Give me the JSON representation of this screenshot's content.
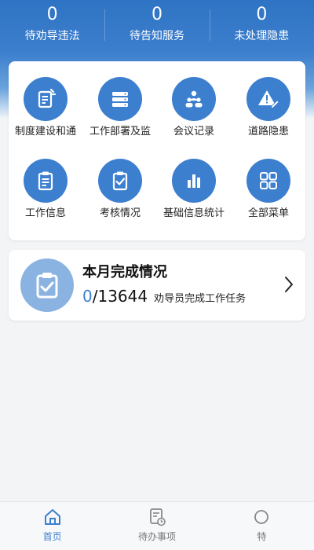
{
  "stats": [
    {
      "value": "0",
      "label": "待劝导违法"
    },
    {
      "value": "0",
      "label": "待告知服务"
    },
    {
      "value": "0",
      "label": "未处理隐患"
    }
  ],
  "menu": [
    {
      "label": "制度建设和通",
      "icon": "document-edit-icon"
    },
    {
      "label": "工作部署及监",
      "icon": "server-list-icon"
    },
    {
      "label": "会议记录",
      "icon": "meeting-people-icon"
    },
    {
      "label": "道路隐患",
      "icon": "warning-edit-icon"
    },
    {
      "label": "工作信息",
      "icon": "clipboard-list-icon"
    },
    {
      "label": "考核情况",
      "icon": "clipboard-check-icon"
    },
    {
      "label": "基础信息统计",
      "icon": "bar-chart-icon"
    },
    {
      "label": "全部菜单",
      "icon": "grid-menu-icon"
    }
  ],
  "month": {
    "title": "本月完成情况",
    "done": "0",
    "total": "/13644",
    "desc": "劝导员完成工作任务"
  },
  "tabs": [
    {
      "label": "首页",
      "icon": "home-icon",
      "active": true
    },
    {
      "label": "待办事项",
      "icon": "todo-list-icon",
      "active": false
    },
    {
      "label": "特",
      "icon": "special-icon",
      "active": false
    }
  ],
  "colors": {
    "primary": "#3d7fcf",
    "hero": "#2f73c4",
    "card": "#ffffff",
    "background": "#f2f4f6"
  }
}
